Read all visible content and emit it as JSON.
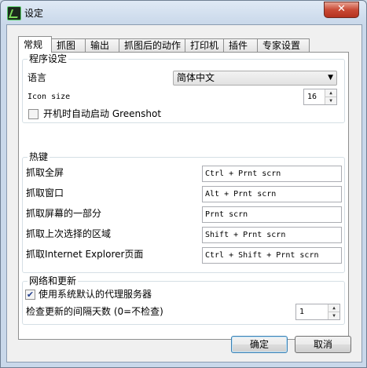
{
  "window": {
    "title": "设定",
    "close_glyph": "✕"
  },
  "tabs": [
    {
      "label": "常规",
      "active": true
    },
    {
      "label": "抓图",
      "active": false
    },
    {
      "label": "输出",
      "active": false
    },
    {
      "label": "抓图后的动作",
      "active": false
    },
    {
      "label": "打印机",
      "active": false
    },
    {
      "label": "插件",
      "active": false
    },
    {
      "label": "专家设置",
      "active": false
    }
  ],
  "program_settings": {
    "group_title": "程序设定",
    "language_label": "语言",
    "language_value": "简体中文",
    "icon_size_label": "Icon size",
    "icon_size_value": "16",
    "autostart_label": "开机时自动启动 Greenshot",
    "autostart_checked": false
  },
  "hotkeys": {
    "group_title": "热键",
    "rows": [
      {
        "label": "抓取全屏",
        "value": "Ctrl + Prnt scrn"
      },
      {
        "label": "抓取窗口",
        "value": "Alt + Prnt scrn"
      },
      {
        "label": "抓取屏幕的一部分",
        "value": "Prnt scrn"
      },
      {
        "label": "抓取上次选择的区域",
        "value": "Shift + Prnt scrn"
      },
      {
        "label": "抓取Internet Explorer页面",
        "value": "Ctrl + Shift + Prnt scrn"
      }
    ]
  },
  "network": {
    "group_title": "网络和更新",
    "proxy_label": "使用系统默认的代理服务器",
    "proxy_checked": true,
    "update_interval_label": "检查更新的间隔天数 (0=不检查)",
    "update_interval_value": "1"
  },
  "buttons": {
    "ok": "确定",
    "cancel": "取消"
  },
  "icons": {
    "app": "greenshot-icon",
    "dropdown": "chevron-down-icon",
    "check": "check-icon",
    "close": "close-icon"
  }
}
